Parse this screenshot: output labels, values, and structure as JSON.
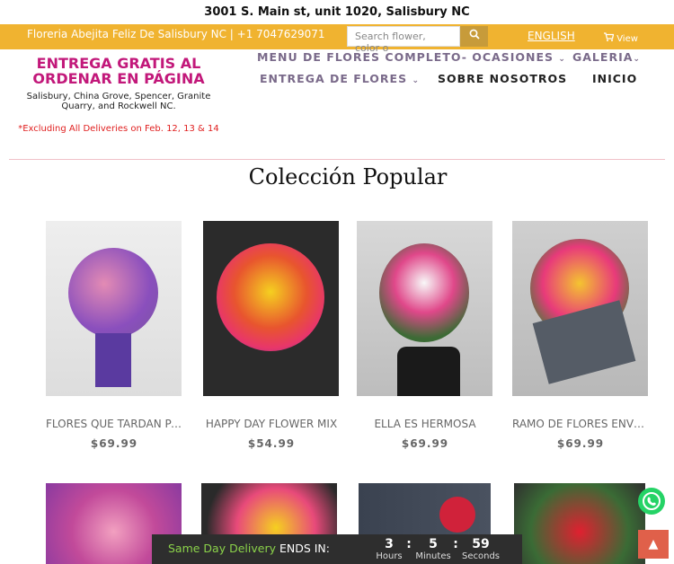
{
  "header": {
    "address": "3001 S. Main st, unit 1020, Salisbury NC",
    "contact": "Floreria Abejita Feliz De Salisbury NC | +1 7047629071",
    "search_placeholder": "Search flower, color o",
    "language": "ENGLISH",
    "cart_label": "View"
  },
  "promo": {
    "title_line1": "ENTREGA GRATIS AL",
    "title_line2": "ORDENAR EN PÁGINA",
    "areas": "Salisbury, China Grove, Spencer, Granite Quarry, and Rockwell NC.",
    "exclusion": "*Excluding All Deliveries on Feb. 12, 13 & 14"
  },
  "nav": {
    "menu": "MENU DE FLORES COMPLETO- OCASIONES",
    "gallery": "GALERIA",
    "delivery": "ENTREGA DE FLORES",
    "about": "SOBRE NOSOTROS",
    "home": "INICIO"
  },
  "section": {
    "title": "Colección Popular"
  },
  "products": [
    {
      "name": "FLORES QUE TARDAN PA...",
      "price": "$69.99"
    },
    {
      "name": "HAPPY DAY FLOWER MIX",
      "price": "$54.99"
    },
    {
      "name": "ELLA ES HERMOSA",
      "price": "$69.99"
    },
    {
      "name": "RAMO DE FLORES ENVUE...",
      "price": "$69.99"
    }
  ],
  "timer": {
    "label_highlight": "Same Day Delivery",
    "label_rest": " ENDS IN:",
    "hours": "3",
    "minutes": "5",
    "seconds": "59",
    "hours_label": "Hours",
    "minutes_label": "Minutes",
    "seconds_label": "Seconds"
  },
  "colors": {
    "accent": "#f0b330",
    "brand": "#c2187a",
    "timer_bg": "#2e2e2e"
  }
}
